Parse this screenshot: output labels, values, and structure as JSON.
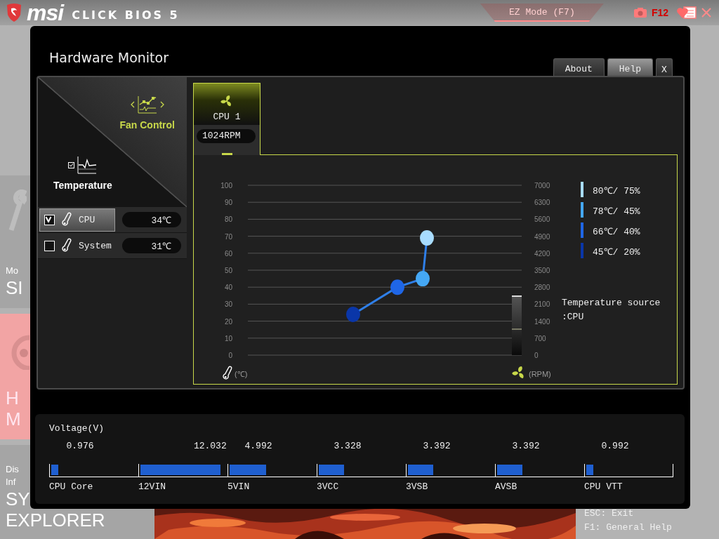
{
  "header": {
    "logo": "msi",
    "product": "CLICK BIOS 5",
    "mode_button": "EZ Mode (F7)",
    "screenshot_key": "F12"
  },
  "side_menu": [
    {
      "captions": [
        "Mo"
      ],
      "titles": [
        "SI"
      ],
      "selected": false
    },
    {
      "titles": [
        "H",
        "M"
      ],
      "selected": true
    },
    {
      "captions": [
        "Dis",
        "Inf"
      ],
      "titles": [
        "SY",
        "EXPLORER"
      ],
      "selected": false
    }
  ],
  "help": [
    "ESC: Exit",
    "F1: General Help"
  ],
  "dialog": {
    "title": "Hardware Monitor",
    "buttons": [
      {
        "label": "About",
        "selected": false
      },
      {
        "label": "Help",
        "selected": true
      },
      {
        "label": "X",
        "selected": false
      }
    ],
    "modes": [
      {
        "label": "Fan Control",
        "selected": true
      },
      {
        "label": "Temperature",
        "selected": false
      }
    ],
    "sensors": [
      {
        "name": "CPU",
        "checked": true,
        "selected": true,
        "value": "34℃"
      },
      {
        "name": "System",
        "checked": false,
        "selected": false,
        "value": "31℃"
      }
    ],
    "fans": [
      {
        "name": "CPU 1",
        "selected": true,
        "speed": "1024RPM"
      }
    ],
    "fan_chart": {
      "temperature_ticks": [
        "100",
        "90",
        "80",
        "70",
        "60",
        "50",
        "40",
        "30",
        "20",
        "10",
        "0"
      ],
      "temperature_unit": "(℃)",
      "rpm_ticks": [
        "7000",
        "6300",
        "5600",
        "4900",
        "4200",
        "3500",
        "2800",
        "2100",
        "1400",
        "700",
        "0"
      ],
      "rpm_unit": "(RPM)",
      "legend": [
        {
          "label": "80℃/ 75%",
          "color": "#a8dcff"
        },
        {
          "label": "78℃/ 45%",
          "color": "#45a8f5"
        },
        {
          "label": "66℃/ 40%",
          "color": "#1f66e6"
        },
        {
          "label": "45℃/ 20%",
          "color": "#0a36a8"
        }
      ],
      "temperature_source": [
        "Temperature source",
        ":CPU"
      ]
    },
    "voltage": {
      "title": "Voltage(V)",
      "rails": [
        {
          "name": "CPU Core",
          "value": "0.976",
          "level": 0.08
        },
        {
          "name": "12VIN",
          "value": "12.032",
          "level": 0.93
        },
        {
          "name": "5VIN",
          "value": "4.992",
          "level": 0.42
        },
        {
          "name": "3VCC",
          "value": "3.328",
          "level": 0.29
        },
        {
          "name": "3VSB",
          "value": "3.392",
          "level": 0.29
        },
        {
          "name": "AVSB",
          "value": "3.392",
          "level": 0.29
        },
        {
          "name": "CPU VTT",
          "value": "0.992",
          "level": 0.08
        }
      ]
    }
  }
}
